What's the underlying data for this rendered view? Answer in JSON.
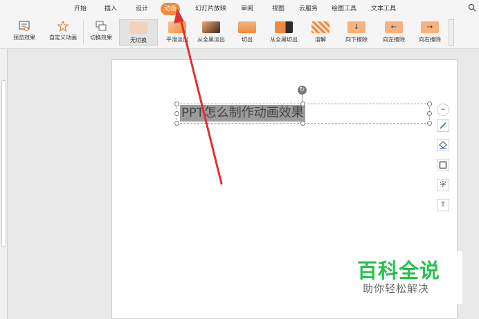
{
  "tabs": [
    {
      "label": "开始",
      "active": false
    },
    {
      "label": "插入",
      "active": false
    },
    {
      "label": "设计",
      "active": false
    },
    {
      "label": "动画",
      "active": true
    },
    {
      "label": "幻灯片放映",
      "active": false
    },
    {
      "label": "审阅",
      "active": false
    },
    {
      "label": "视图",
      "active": false
    },
    {
      "label": "云服务",
      "active": false
    },
    {
      "label": "绘图工具",
      "active": false
    },
    {
      "label": "文本工具",
      "active": false
    }
  ],
  "ribbon": {
    "preview_label": "预览效果",
    "custom_anim_label": "自定义动画",
    "switch_effect_label": "切换效果",
    "effects": [
      {
        "label": "无切换",
        "selected": true
      },
      {
        "label": "平滑淡出",
        "selected": false
      },
      {
        "label": "从全黑淡出",
        "selected": false
      },
      {
        "label": "切出",
        "selected": false
      },
      {
        "label": "从全黑切出",
        "selected": false
      },
      {
        "label": "溶解",
        "selected": false
      },
      {
        "label": "向下擦除",
        "selected": false
      },
      {
        "label": "向左擦除",
        "selected": false
      },
      {
        "label": "向右擦除",
        "selected": false
      }
    ]
  },
  "slide": {
    "title_text": "PPT怎么制作动画效果"
  },
  "side_tools": [
    {
      "icon": "collapse-icon"
    },
    {
      "icon": "brush-icon"
    },
    {
      "icon": "fill-icon"
    },
    {
      "icon": "outline-icon"
    },
    {
      "icon": "text-style-icon",
      "glyph": "字"
    },
    {
      "icon": "textbox-icon",
      "glyph": "T"
    }
  ],
  "watermark": {
    "title": "百科全说",
    "subtitle": "助你轻松解决"
  },
  "colors": {
    "accent": "#f08a3c",
    "arrow": "#e0312f",
    "watermark_green": "#27c24c"
  }
}
